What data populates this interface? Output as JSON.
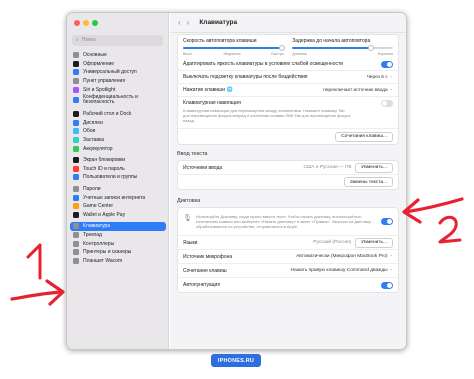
{
  "colors": {
    "accent": "#2f7df6",
    "annotation": "#e8212f",
    "watermark_bg": "#2d6fe0"
  },
  "window": {
    "traffic_lights": [
      "#ff5f57",
      "#febc2e",
      "#28c840"
    ]
  },
  "sidebar": {
    "search_placeholder": "Поиск",
    "items": [
      {
        "label": "Основные",
        "icon": "gear-icon",
        "color": "#8e8e93"
      },
      {
        "label": "Оформление",
        "icon": "appearance-icon",
        "color": "#1c1c1e"
      },
      {
        "label": "Универсальный доступ",
        "icon": "accessibility-icon",
        "color": "#2f7df6"
      },
      {
        "label": "Пункт управления",
        "icon": "control-center-icon",
        "color": "#8e8e93"
      },
      {
        "label": "Siri и Spotlight",
        "icon": "siri-icon",
        "color": "#a855f7"
      },
      {
        "label": "Конфиденциальность и безопасность",
        "icon": "hand-icon",
        "color": "#2f7df6"
      },
      {
        "label": "Рабочий стол и Dock",
        "icon": "dock-icon",
        "color": "#1c1c1e"
      },
      {
        "label": "Дисплеи",
        "icon": "display-icon",
        "color": "#2f7df6"
      },
      {
        "label": "Обои",
        "icon": "wallpaper-icon",
        "color": "#38bdf8"
      },
      {
        "label": "Заставка",
        "icon": "screensaver-icon",
        "color": "#2dd4bf"
      },
      {
        "label": "Аккумулятор",
        "icon": "battery-icon",
        "color": "#34c759"
      },
      {
        "label": "Экран блокировки",
        "icon": "lock-screen-icon",
        "color": "#1c1c1e"
      },
      {
        "label": "Touch ID и пароль",
        "icon": "fingerprint-icon",
        "color": "#ff3b30"
      },
      {
        "label": "Пользователи и группы",
        "icon": "users-icon",
        "color": "#2f7df6"
      },
      {
        "label": "Пароли",
        "icon": "key-icon",
        "color": "#8e8e93"
      },
      {
        "label": "Учетные записи интернета",
        "icon": "at-icon",
        "color": "#2f7df6"
      },
      {
        "label": "Game Center",
        "icon": "game-center-icon",
        "color": "#ff9f0a"
      },
      {
        "label": "Wallet и Apple Pay",
        "icon": "wallet-icon",
        "color": "#1c1c1e"
      },
      {
        "label": "Клавиатура",
        "icon": "keyboard-icon",
        "color": "#8e8e93"
      },
      {
        "label": "Трекпад",
        "icon": "trackpad-icon",
        "color": "#8e8e93"
      },
      {
        "label": "Контроллеры",
        "icon": "gamepad-icon",
        "color": "#8e8e93"
      },
      {
        "label": "Принтеры и сканеры",
        "icon": "printer-icon",
        "color": "#8e8e93"
      },
      {
        "label": "Планшет Wacom",
        "icon": "tablet-icon",
        "color": "#8e8e93"
      }
    ]
  },
  "header": {
    "back": "‹",
    "forward": "›",
    "title": "Клавиатура"
  },
  "sliders": {
    "repeat": {
      "label": "Скорость автоповтора клавиши",
      "left": "Выкл.",
      "left2": "Медленно",
      "right": "Быстро",
      "value": 0.98
    },
    "delay": {
      "label": "Задержка до начала автоповтора",
      "left": "Длинная",
      "right": "Короткая",
      "value": 0.78
    }
  },
  "rows": {
    "adjust_brightness": {
      "label": "Адаптировать яркость клавиатуры в условиях слабой освещенности",
      "on": true
    },
    "backlight_off": {
      "label": "Выключать подсветку клавиатуры после бездействия",
      "value": "Через 5 с"
    },
    "globe_key": {
      "label": "Нажатие клавиши",
      "value": "переключает источник ввода"
    },
    "keyboard_nav": {
      "label": "Клавиатурная навигация",
      "desc": "Клавиатурная навигация для перемещения между элементами. Нажмите клавишу Tab для перемещения фокуса вперед и сочетание клавиш Shift Tab для перемещения фокуса назад.",
      "on": false
    },
    "shortcuts_button": "Сочетания клавиш..."
  },
  "text_input": {
    "section": "Ввод текста",
    "sources_label": "Источники ввода",
    "sources_value": "США и Русская — ПК",
    "edit_button": "Изменить...",
    "replace_button": "Замены текста..."
  },
  "dictation": {
    "section": "Диктовка",
    "desc": "Используйте Диктовку, когда нужно ввести текст. Чтобы начать диктовку, воспользуйтесь сочетанием клавиш или выберите «Начать диктовку» в меню «Правка». Запросы на диктовку обрабатываются на устройстве, отправляются в Apple.",
    "on": true,
    "language_label": "Языки",
    "language_value": "Русский (Россия)",
    "language_button": "Изменить...",
    "mic_label": "Источник микрофона",
    "mic_value": "Автоматически (Микрофон MacBook Pro)",
    "shortcut_label": "Сочетание клавиш",
    "shortcut_value": "Нажать правую клавишу Command дважды",
    "punct_label": "Автопунктуация",
    "punct_on": true
  },
  "watermark": "IPHONES.RU",
  "annotations": {
    "one": "1",
    "two": "2"
  }
}
